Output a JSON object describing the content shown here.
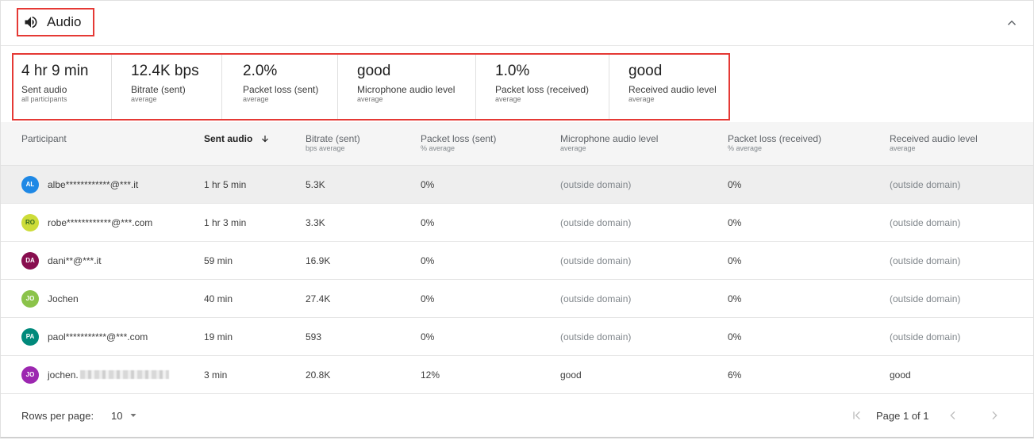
{
  "header": {
    "title": "Audio",
    "title_icon": "speaker-icon",
    "collapse_icon": "chevron-up-icon"
  },
  "summary": [
    {
      "value": "4 hr 9 min",
      "label": "Sent audio",
      "sub": "all participants"
    },
    {
      "value": "12.4K bps",
      "label": "Bitrate (sent)",
      "sub": "average"
    },
    {
      "value": "2.0%",
      "label": "Packet loss (sent)",
      "sub": "average"
    },
    {
      "value": "good",
      "label": "Microphone audio level",
      "sub": "average"
    },
    {
      "value": "1.0%",
      "label": "Packet loss (received)",
      "sub": "average"
    },
    {
      "value": "good",
      "label": "Received audio level",
      "sub": "average"
    }
  ],
  "columns": [
    {
      "label": "Participant",
      "sub": ""
    },
    {
      "label": "Sent audio",
      "sub": "",
      "sorted": "desc"
    },
    {
      "label": "Bitrate (sent)",
      "sub": "bps average"
    },
    {
      "label": "Packet loss (sent)",
      "sub": "% average"
    },
    {
      "label": "Microphone audio level",
      "sub": "average"
    },
    {
      "label": "Packet loss (received)",
      "sub": "% average"
    },
    {
      "label": "Received audio level",
      "sub": "average"
    }
  ],
  "rows": [
    {
      "initials": "AL",
      "color": "#1e88e5",
      "name": "albe************@***.it",
      "sent": "1 hr 5 min",
      "bitrate": "5.3K",
      "loss_sent": "0%",
      "mic": "(outside domain)",
      "loss_recv": "0%",
      "recv_level": "(outside domain)"
    },
    {
      "initials": "RO",
      "color": "#cddc39",
      "name": "robe************@***.com",
      "sent": "1 hr 3 min",
      "bitrate": "3.3K",
      "loss_sent": "0%",
      "mic": "(outside domain)",
      "loss_recv": "0%",
      "recv_level": "(outside domain)"
    },
    {
      "initials": "DA",
      "color": "#880e4f",
      "name": "dani**@***.it",
      "sent": "59 min",
      "bitrate": "16.9K",
      "loss_sent": "0%",
      "mic": "(outside domain)",
      "loss_recv": "0%",
      "recv_level": "(outside domain)"
    },
    {
      "initials": "JO",
      "color": "#8bc34a",
      "name": "Jochen",
      "sent": "40 min",
      "bitrate": "27.4K",
      "loss_sent": "0%",
      "mic": "(outside domain)",
      "loss_recv": "0%",
      "recv_level": "(outside domain)"
    },
    {
      "initials": "PA",
      "color": "#00897b",
      "name": "paol***********@***.com",
      "sent": "19 min",
      "bitrate": "593",
      "loss_sent": "0%",
      "mic": "(outside domain)",
      "loss_recv": "0%",
      "recv_level": "(outside domain)"
    },
    {
      "initials": "JO",
      "color": "#9c27b0",
      "name": "jochen.",
      "name_redacted": true,
      "sent": "3 min",
      "bitrate": "20.8K",
      "loss_sent": "12%",
      "mic": "good",
      "loss_recv": "6%",
      "recv_level": "good"
    }
  ],
  "footer": {
    "rows_per_page_label": "Rows per page:",
    "rows_per_page_value": "10",
    "page_label": "Page 1 of 1"
  }
}
